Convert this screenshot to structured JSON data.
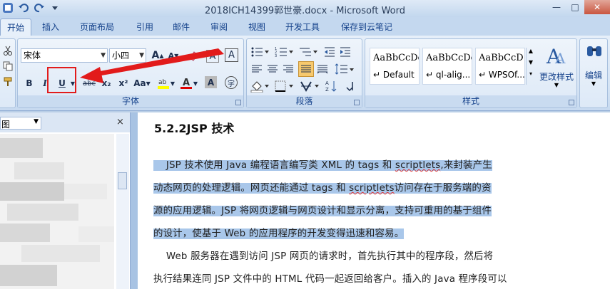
{
  "window": {
    "title": "2018ICH14399郭世豪.docx - Microsoft Word"
  },
  "tabs": [
    "开始",
    "插入",
    "页面布局",
    "引用",
    "邮件",
    "审阅",
    "视图",
    "开发工具",
    "保存到云笔记"
  ],
  "font_group": {
    "label": "字体",
    "font_name": "宋体",
    "font_size": "小四",
    "bold": "B",
    "italic": "I",
    "underline": "U",
    "strike": "abc",
    "subscript": "x₂",
    "superscript": "x²",
    "change_case": "Aa",
    "grow": "A",
    "shrink": "A",
    "char_border": "A",
    "char_shade": "A",
    "phonetic": "A",
    "enclose": "字"
  },
  "paragraph_group": {
    "label": "段落"
  },
  "styles_group": {
    "label": "样式",
    "styles": [
      {
        "preview": "AaBbCcDc",
        "name": "↵ Default"
      },
      {
        "preview": "AaBbCcDc",
        "name": "↵ ql-alig..."
      },
      {
        "preview": "AaBbCcD",
        "name": "↵ WPSOf..."
      }
    ],
    "change_styles": "更改样式",
    "edit": "编辑"
  },
  "nav": {
    "dropdown_label": "图",
    "close": "×"
  },
  "document": {
    "heading": "5.2.2JSP 技术",
    "lines": [
      {
        "parts": [
          {
            "t": "    JSP 技术使用 Java 编程语言编写类 XML 的 tags 和 ",
            "sel": true
          },
          {
            "t": "scriptlets",
            "sel": true,
            "squig": true
          },
          {
            "t": ",来封装产生",
            "sel": true
          }
        ]
      },
      {
        "parts": [
          {
            "t": "动态网页的处理逻辑。网页还能通过 tags 和 ",
            "sel": true
          },
          {
            "t": "scriptlets",
            "sel": true,
            "squig": true
          },
          {
            "t": "访问存在于服务端的资",
            "sel": true
          }
        ]
      },
      {
        "parts": [
          {
            "t": "源的应用逻辑。JSP 将网页逻辑与网页设计和显示分离，支持可重用的基于组件",
            "sel": true
          }
        ]
      },
      {
        "parts": [
          {
            "t": "的设计，使基于 Web 的应用程序的开发变得迅速和容易。",
            "sel": true
          }
        ]
      },
      {
        "parts": [
          {
            "t": "    Web 服务器在遇到访问 JSP 网页的请求时，首先执行其中的程序段，然后将",
            "sel": false
          }
        ]
      },
      {
        "parts": [
          {
            "t": "执行结果连同 JSP 文件中的 HTML 代码一起返回给客户。插入的 Java 程序段可以",
            "sel": false
          }
        ]
      }
    ]
  },
  "colors": {
    "selection": "#a9c7ea",
    "highlight_box": "#e21b1b",
    "ribbon_text": "#15428b"
  }
}
